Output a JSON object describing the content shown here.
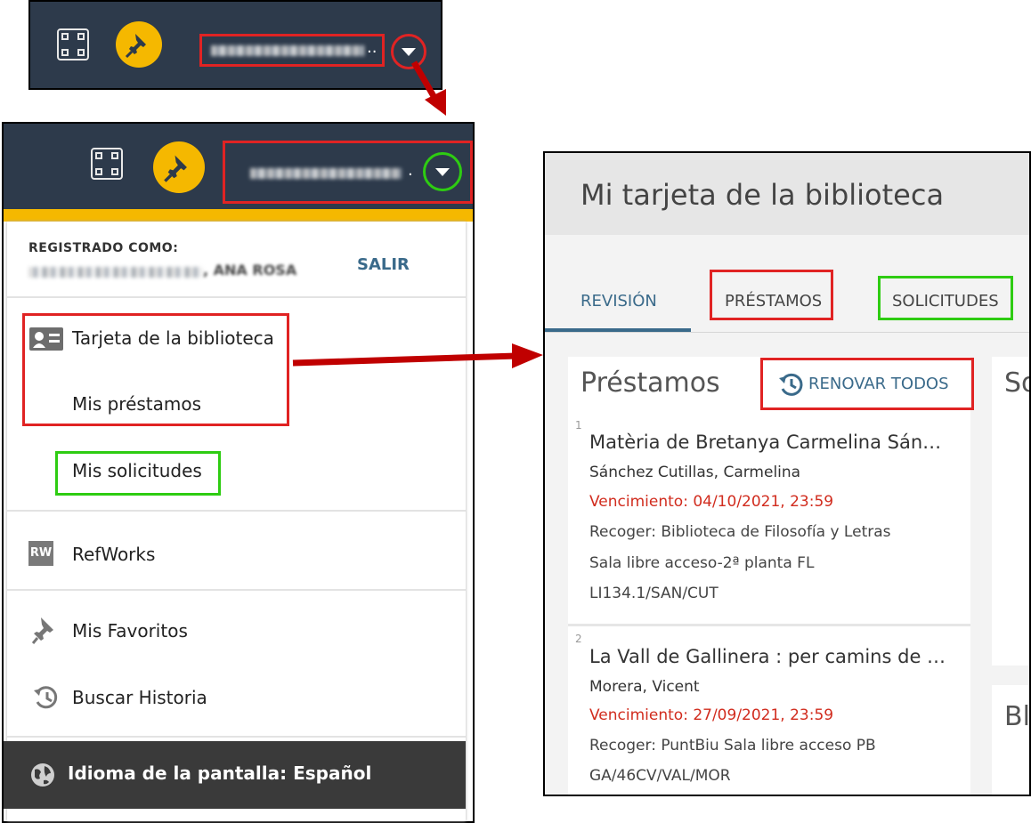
{
  "header_collapsed": {
    "user_name_blurred": true,
    "qr_icon": "qr-code-icon",
    "pin_icon": "pin-icon",
    "dropdown_icon": "chevron-down-icon"
  },
  "header_expanded": {
    "user_name_blurred": true
  },
  "menu": {
    "logged_in_label": "REGISTRADO COMO:",
    "user_suffix": "ANA ROSA",
    "logout_label": "SALIR",
    "items": [
      {
        "label": "Tarjeta de la biblioteca",
        "icon": "id-card-icon"
      },
      {
        "label": "Mis préstamos"
      },
      {
        "label": "Mis solicitudes"
      },
      {
        "label": "RefWorks",
        "icon": "refworks-icon",
        "icon_text": "RW"
      },
      {
        "label": "Mis Favoritos",
        "icon": "pin-icon"
      },
      {
        "label": "Buscar Historia",
        "icon": "history-icon"
      }
    ],
    "language_label": "Idioma de la pantalla: Español",
    "language_icon": "globe-icon"
  },
  "card": {
    "title": "Mi tarjeta de la biblioteca",
    "tabs": [
      "REVISIÓN",
      "PRÉSTAMOS",
      "SOLICITUDES"
    ],
    "active_tab": "REVISIÓN",
    "loans_heading": "Préstamos",
    "renew_all_label": "RENOVAR TODOS",
    "side_heading_1": "So",
    "side_heading_2": "Bl",
    "loans": [
      {
        "index": "1",
        "title": "Matèria de Bretanya Carmelina Sán…",
        "author": "Sánchez Cutillas, Carmelina",
        "due": "Vencimiento: 04/10/2021, 23:59",
        "pickup": "Recoger: Biblioteca de Filosofía y Letras",
        "location": "Sala libre acceso-2ª planta FL",
        "callnumber": "LI134.1/SAN/CUT"
      },
      {
        "index": "2",
        "title": "La Vall de Gallinera : per camins de …",
        "author": "Morera, Vicent",
        "due": "Vencimiento: 27/09/2021, 23:59",
        "pickup": "Recoger: PuntBiu Sala libre acceso PB",
        "callnumber": "GA/46CV/VAL/MOR"
      }
    ]
  },
  "colors": {
    "header_bg": "#2d3a4b",
    "accent_yellow": "#f5b800",
    "highlight_red": "#e02323",
    "highlight_green": "#2ecc12",
    "link_blue": "#3a6a8a",
    "due_red": "#d12c1e"
  }
}
